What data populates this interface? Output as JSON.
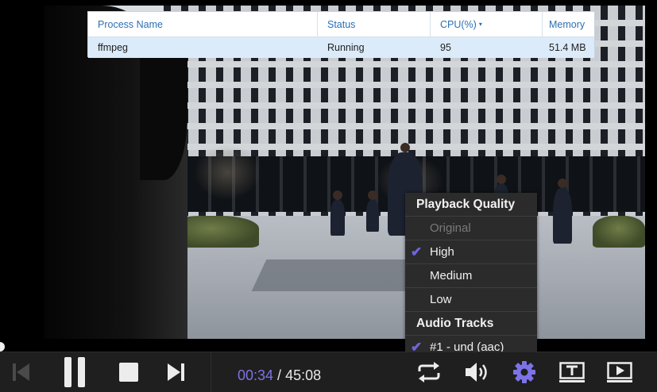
{
  "process_table": {
    "headers": {
      "name": "Process Name",
      "status": "Status",
      "cpu": "CPU(%)",
      "memory": "Memory"
    },
    "sort_indicator": "▾",
    "rows": [
      {
        "name": "ffmpeg",
        "status": "Running",
        "cpu": "95",
        "memory": "51.4 MB"
      }
    ]
  },
  "settings_menu": {
    "quality_title": "Playback Quality",
    "quality_options": [
      {
        "label": "Original",
        "disabled": true,
        "selected": false
      },
      {
        "label": "High",
        "disabled": false,
        "selected": true
      },
      {
        "label": "Medium",
        "disabled": false,
        "selected": false
      },
      {
        "label": "Low",
        "disabled": false,
        "selected": false
      }
    ],
    "audio_title": "Audio Tracks",
    "audio_options": [
      {
        "label": "#1 - und (aac)",
        "selected": true
      }
    ],
    "check_glyph": "✔"
  },
  "player": {
    "current_time": "00:34",
    "separator": " / ",
    "duration": "45:08",
    "accent_color": "#7d73e6",
    "icons": [
      "skip-previous-icon",
      "pause-icon",
      "stop-icon",
      "skip-next-icon",
      "repeat-icon",
      "volume-icon",
      "settings-gear-icon",
      "subtitles-icon",
      "cast-icon"
    ]
  }
}
